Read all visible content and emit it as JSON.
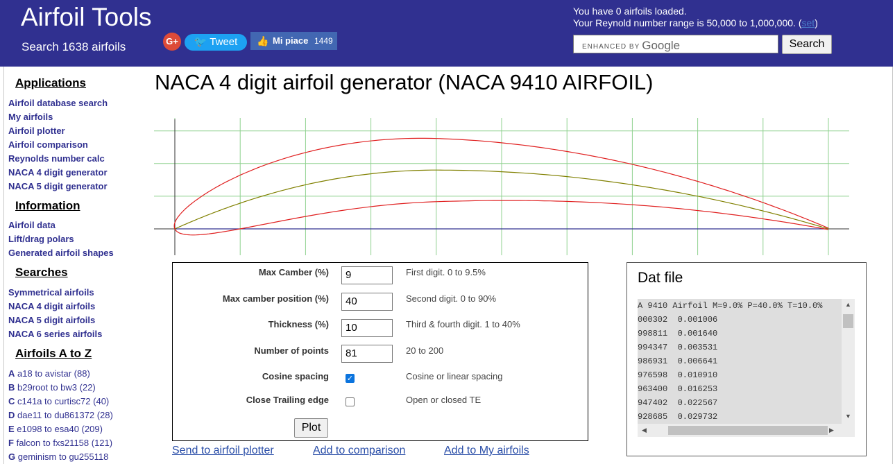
{
  "header": {
    "brand_title": "Airfoil Tools",
    "brand_sub": "Search 1638 airfoils",
    "gplus_label": "G+",
    "tweet_label": "Tweet",
    "like_label": "Mi piace",
    "like_count": "1449",
    "info_line1": "You have 0 airfoils loaded.",
    "info_line2": "Your Reynold number range is 50,000 to 1,000,000. (",
    "info_set": "set",
    "info_close": ")",
    "search_enhanced": "ENHANCED BY",
    "search_google": "Google",
    "search_button": "Search",
    "colors": {
      "bar": "#303090",
      "tweet": "#1da1f2",
      "like": "#4267b2",
      "gplus": "#dd4b39"
    }
  },
  "sidebar": {
    "applications_head": "Applications",
    "applications": [
      "Airfoil database search",
      "My airfoils",
      "Airfoil plotter",
      "Airfoil comparison",
      "Reynolds number calc",
      "NACA 4 digit generator",
      "NACA 5 digit generator"
    ],
    "information_head": "Information",
    "information": [
      "Airfoil data",
      "Lift/drag polars",
      "Generated airfoil shapes"
    ],
    "searches_head": "Searches",
    "searches": [
      "Symmetrical airfoils",
      "NACA 4 digit airfoils",
      "NACA 5 digit airfoils",
      "NACA 6 series airfoils"
    ],
    "az_head": "Airfoils A to Z",
    "az": [
      {
        "letter": "A",
        "text": "a18 to avistar (88)"
      },
      {
        "letter": "B",
        "text": "b29root to bw3 (22)"
      },
      {
        "letter": "C",
        "text": "c141a to curtisc72 (40)"
      },
      {
        "letter": "D",
        "text": "dae11 to du861372 (28)"
      },
      {
        "letter": "E",
        "text": "e1098 to esa40 (209)"
      },
      {
        "letter": "F",
        "text": "falcon to fxs21158 (121)"
      },
      {
        "letter": "G",
        "text": "geminism to gu255118"
      }
    ]
  },
  "main": {
    "title": "NACA 4 digit airfoil generator (NACA 9410 AIRFOIL)"
  },
  "chart_data": {
    "type": "line",
    "airfoil": {
      "max_camber": 0.09,
      "camber_position": 0.4,
      "thickness": 0.1
    },
    "series": [
      {
        "style": "upper surface",
        "color": "#e02020"
      },
      {
        "style": "lower surface",
        "color": "#e02020"
      },
      {
        "style": "camber line",
        "color": "#808000"
      },
      {
        "style": "chord line",
        "color": "#303090"
      }
    ],
    "grid": true,
    "grid_color": "#8fd18f"
  },
  "form": {
    "fields": [
      {
        "label": "Max Camber (%)",
        "value": "9",
        "desc": "First digit. 0 to 9.5%"
      },
      {
        "label": "Max camber position (%)",
        "value": "40",
        "desc": "Second digit. 0 to 90%"
      },
      {
        "label": "Thickness (%)",
        "value": "10",
        "desc": "Third & fourth digit. 1 to 40%"
      },
      {
        "label": "Number of points",
        "value": "81",
        "desc": "20 to 200"
      }
    ],
    "cosine_label": "Cosine spacing",
    "cosine_checked": true,
    "cosine_desc": "Cosine or linear spacing",
    "closete_label": "Close Trailing edge",
    "closete_checked": false,
    "closete_desc": "Open or closed TE",
    "plot_button": "Plot"
  },
  "links": {
    "send_plotter": "Send to airfoil plotter",
    "add_comparison": "Add to comparison",
    "add_my": "Add to My airfoils"
  },
  "dat": {
    "title": "Dat file",
    "lines": [
      "A 9410 Airfoil M=9.0% P=40.0% T=10.0%",
      "000302  0.001006",
      "998811  0.001640",
      "994347  0.003531",
      "986931  0.006641",
      "976598  0.010910",
      "963400  0.016253",
      "947402  0.022567",
      "928685  0.029732"
    ],
    "arrow_up": "▲",
    "arrow_down": "▼",
    "arrow_left": "◀",
    "arrow_right": "▶"
  }
}
